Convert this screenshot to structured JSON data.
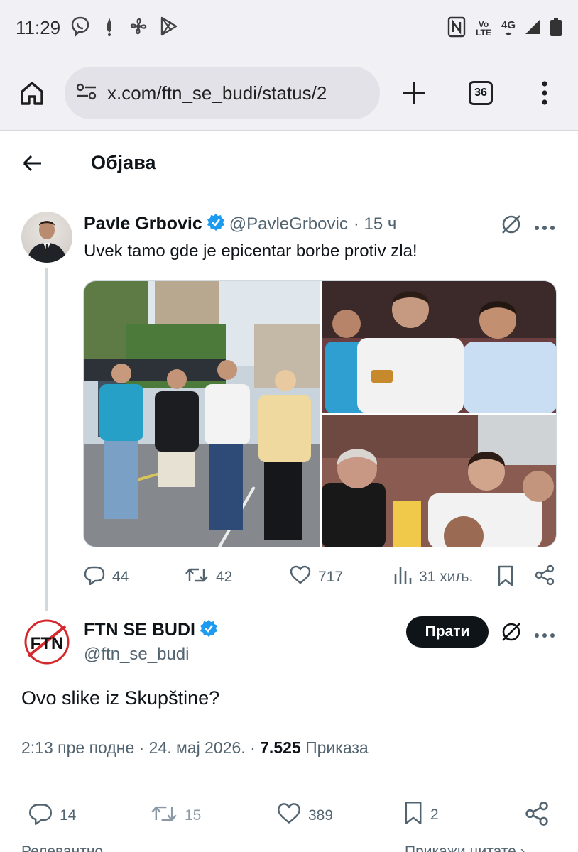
{
  "status_bar": {
    "time": "11:29",
    "left_icons": [
      "viber-icon",
      "notification-icon",
      "fan-icon",
      "play-store-icon"
    ],
    "nfc_label": "N",
    "volte_label": "Vo LTE",
    "network_label": "4G"
  },
  "browser": {
    "url": "x.com/ftn_se_budi/status/2",
    "tab_count": "36"
  },
  "page": {
    "title": "Објава"
  },
  "parent_tweet": {
    "name": "Pavle Grbovic",
    "handle": "@PavleGrbovic",
    "time": "· 15 ч",
    "text": "Uvek tamo gde je epicentar borbe protiv zla!",
    "replies": "44",
    "reposts": "42",
    "likes": "717",
    "views": "31 хиљ."
  },
  "main_tweet": {
    "name": "FTN SE BUDI",
    "handle": "@ftn_se_budi",
    "follow_label": "Прати",
    "avatar_text": "FTN",
    "text": "Ovo slike iz Skupštine?",
    "timestamp": "2:13 пре подне · 24. мај 2026. ·",
    "views_count": "7.525",
    "views_label": "Приказа",
    "replies": "14",
    "reposts": "15",
    "likes": "389",
    "bookmarks": "2"
  },
  "bottom": {
    "left": "Релевантно",
    "right": "Прикажи цитате ›"
  },
  "colors": {
    "accent": "#1d9bf0",
    "text": "#0f1419",
    "secondary": "#536471",
    "chrome": "#f1f0f5"
  }
}
